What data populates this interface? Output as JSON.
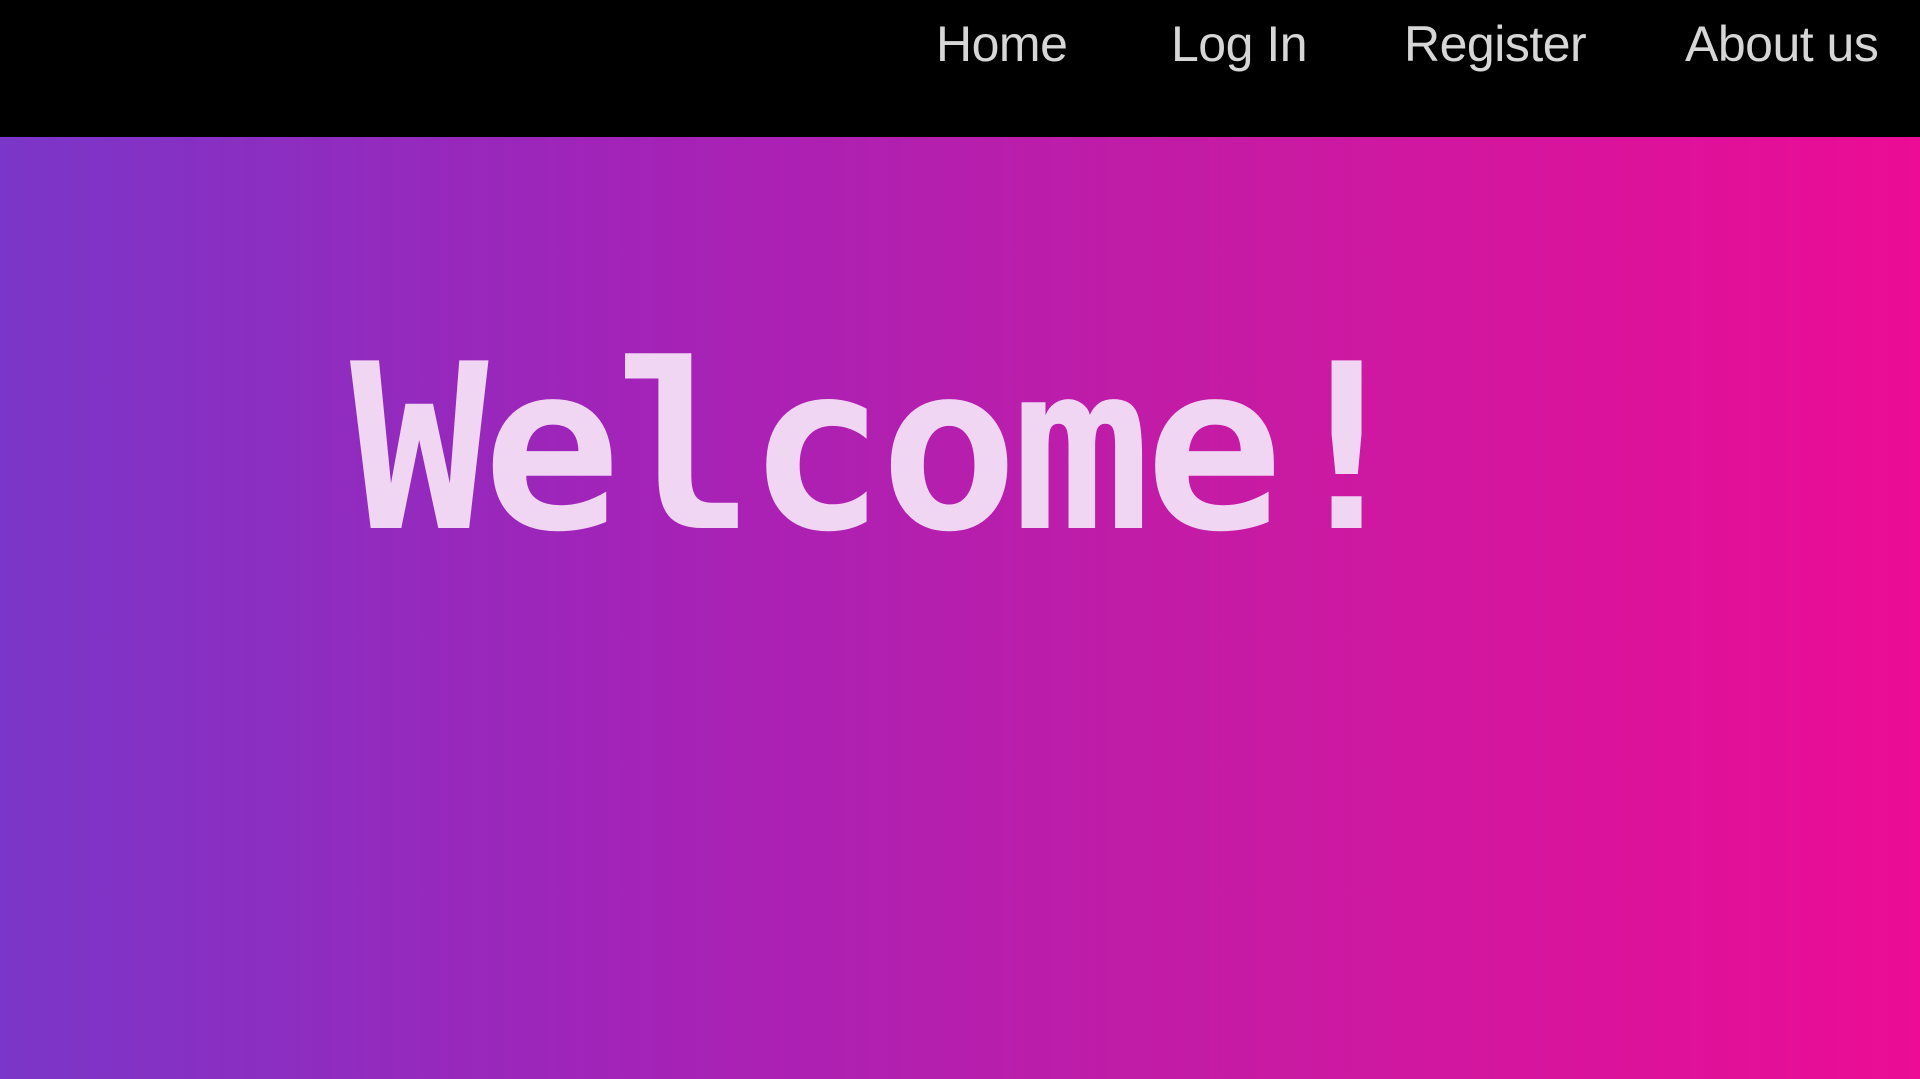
{
  "nav": {
    "items": [
      {
        "label": "Home"
      },
      {
        "label": "Log In"
      },
      {
        "label": "Register"
      },
      {
        "label": "About us"
      }
    ]
  },
  "hero": {
    "title": "Welcome!"
  },
  "colors": {
    "navbar_bg": "#000000",
    "nav_text": "#d6d6d6",
    "gradient_left": "#7a36c8",
    "gradient_right": "#ec0c95",
    "title_text": "#f0d6f3"
  }
}
